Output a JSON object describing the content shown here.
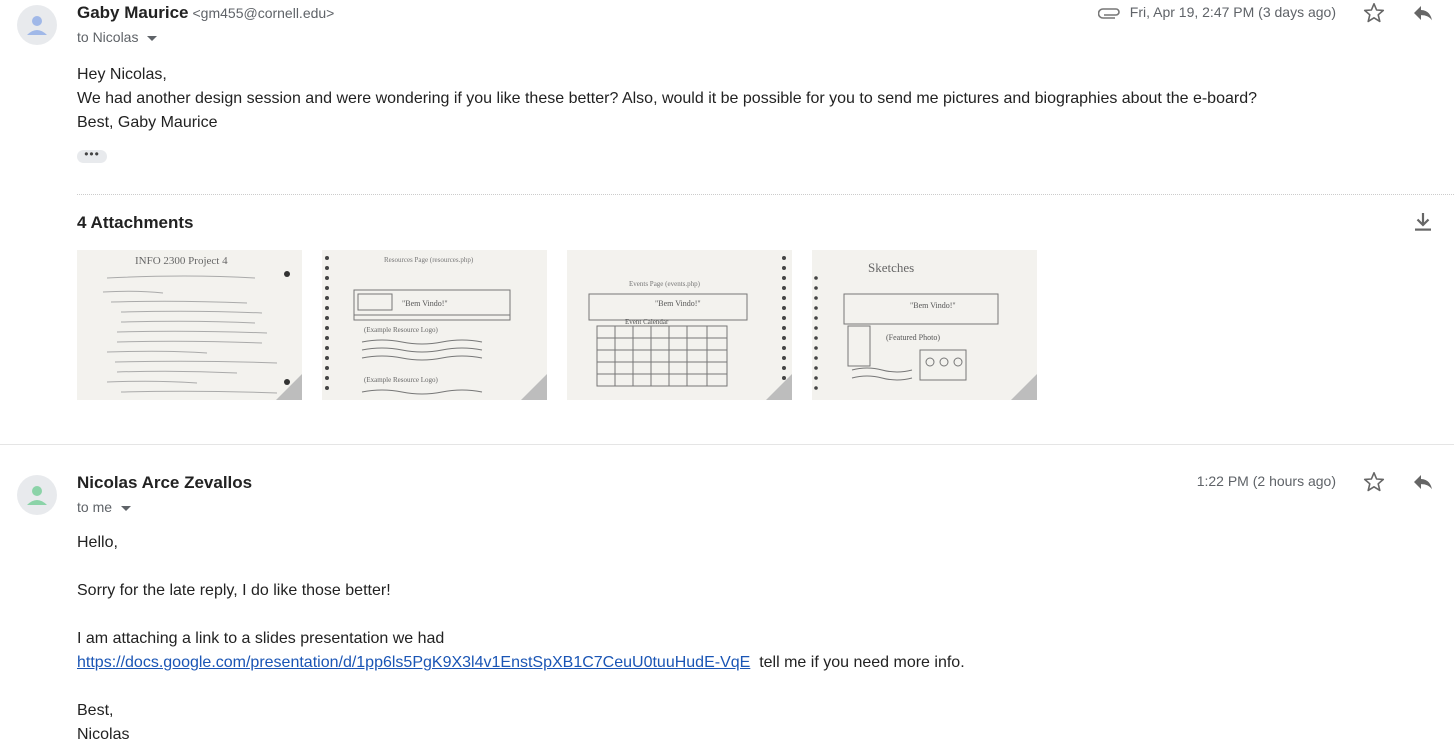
{
  "message1": {
    "sender_name": "Gaby Maurice",
    "sender_email": "<gm455@cornell.edu>",
    "to": "to Nicolas",
    "date": "Fri, Apr 19, 2:47 PM (3 days ago)",
    "body": [
      "Hey Nicolas,",
      "We had another design session  and were wondering if you like these better? Also, would it be possible for you to send me pictures and biographies about the e-board?",
      "Best, Gaby Maurice"
    ],
    "dots": "•••",
    "attachments_title": "4 Attachments",
    "attachments": [
      {
        "title": "INFO 2300 Project 4",
        "kind": "notes"
      },
      {
        "title": "Resources Page (resources.php)",
        "kind": "resources"
      },
      {
        "title": "Events Page (events.php)",
        "kind": "events"
      },
      {
        "title": "Sketches",
        "kind": "sketches"
      }
    ]
  },
  "message2": {
    "sender_name": "Nicolas Arce Zevallos",
    "to": "to me",
    "date": "1:22 PM (2 hours ago)",
    "greeting": "Hello,",
    "line1": "Sorry for the late reply, I do like those better!",
    "line2": "I am attaching a link to a slides presentation we had",
    "link": "https://docs.google.com/presentation/d/1pp6ls5PgK9X3l4v1EnstSpXB1C7CeuU0tuuHudE-VqE",
    "after_link": "  tell me if you need more info.",
    "closing": "Best,",
    "signature": "Nicolas"
  },
  "icons": {
    "avatar": "person-icon",
    "attachment": "paperclip-icon",
    "star": "star-icon",
    "reply": "reply-icon",
    "download": "download-icon"
  },
  "colors": {
    "avatar1": "#a0b8e8",
    "avatar2": "#8bd3a8",
    "link": "#1a55b5"
  }
}
